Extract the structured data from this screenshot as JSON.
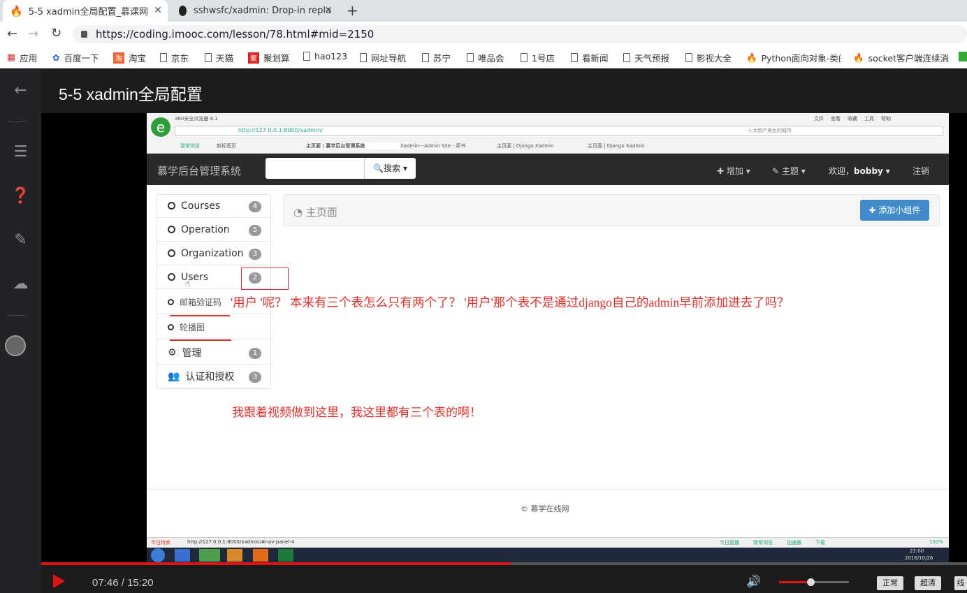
{
  "browser": {
    "tabs": [
      {
        "title": "5-5 xadmin全局配置_慕课网"
      },
      {
        "title": "sshwsfc/xadmin: Drop-in repla"
      }
    ],
    "new_tab": "+",
    "url": "https://coding.imooc.com/lesson/78.html#mid=2150",
    "bookmarks": [
      "应用",
      "百度一下",
      "淘宝",
      "京东",
      "天猫",
      "聚划算",
      "hao123",
      "网址导航",
      "苏宁",
      "唯品会",
      "1号店",
      "看新闻",
      "天气预报",
      "影视大全",
      "Python面向对象-类的",
      "socket客户端连续消"
    ]
  },
  "player": {
    "title": "5-5 xadmin全局配置",
    "time_current": "07:46",
    "time_separator": "/",
    "time_total": "15:20",
    "progress": 0.507,
    "volume": 0.45,
    "quality_buttons": [
      "正常",
      "超清",
      "线"
    ]
  },
  "inner": {
    "browser_name": "360安全浏览器 8.1",
    "url": "http://127.0.0.1:8000/xadmin/",
    "search_hint": "十大超产美女的城市",
    "tabs": [
      "我常浏览",
      "新标签页",
      "主页面 | 慕学后台管理系统",
      "Xadmin---Admin Site - 简书",
      "主页面 | Django Xadmin",
      "主页面 | Django Xadmin"
    ],
    "menu_items": [
      "文件",
      "查看",
      "收藏",
      "工具",
      "帮助"
    ],
    "site_title": "慕学后台管理系统",
    "search_button": "搜索",
    "nav_add": "增加",
    "nav_theme": "主题",
    "nav_welcome": "欢迎，",
    "nav_user": "bobby",
    "nav_logout": "注销",
    "sidebar": [
      {
        "label": "Courses",
        "count": "4"
      },
      {
        "label": "Operation",
        "count": "5"
      },
      {
        "label": "Organization",
        "count": "3"
      },
      {
        "label": "Users",
        "count": "2"
      },
      {
        "label": "邮箱验证码",
        "count": ""
      },
      {
        "label": "轮播图",
        "count": ""
      },
      {
        "label": "管理",
        "count": "1"
      },
      {
        "label": "认证和授权",
        "count": "3"
      }
    ],
    "page_title": "主页面",
    "add_widget": "添加小组件",
    "footer": "© 慕学在线网",
    "status_url": "http://127.0.0.1:8000/xadmin/#nav-panel-4",
    "status_left": "今日特卖",
    "status_items": [
      "今日直播",
      "我常浏览",
      "加速器",
      "下载"
    ],
    "zoom": "150%",
    "clock": "22:00",
    "date": "2016/10/26",
    "annotation_1": "'用户 '呢？ 本来有三个表怎么只有两个了？ '用户'那个表不是通过django自己的admin早前添加进去了吗？",
    "annotation_2": "我跟着视频做到这里，我这里都有三个表的啊！"
  },
  "colors": {
    "accent_red": "#e0302c",
    "button_blue": "#428bca",
    "progress_red": "#e01212"
  }
}
